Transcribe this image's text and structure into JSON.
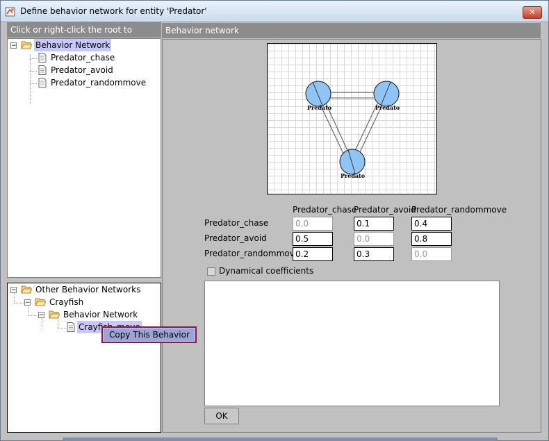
{
  "window": {
    "title": "Define behavior network for entity 'Predator'",
    "close_glyph": "✕"
  },
  "left_header": "Click or right-click the root to continue.",
  "tree_top": {
    "root": {
      "label": "Behavior Network",
      "toggle": "−"
    },
    "children": [
      "Predator_chase",
      "Predator_avoid",
      "Predator_randommove"
    ]
  },
  "tree_bottom": {
    "root": {
      "label": "Other Behavior Networks",
      "toggle": "−"
    },
    "crayfish": {
      "label": "Crayfish",
      "toggle": "−"
    },
    "behavior_network": {
      "label": "Behavior Network",
      "toggle": "−"
    },
    "leaf": {
      "label": "Crayfish_move"
    }
  },
  "context_menu": {
    "item": "Copy This Behavior"
  },
  "right_header": "Behavior network",
  "graph": {
    "node_label": "Predato"
  },
  "matrix": {
    "columns": [
      "Predator_chase",
      "Predator_avoid",
      "Predator_randommove"
    ],
    "rows": [
      {
        "label": "Predator_chase",
        "values": [
          "0.0",
          "0.1",
          "0.4"
        ]
      },
      {
        "label": "Predator_avoid",
        "values": [
          "0.5",
          "0.0",
          "0.8"
        ]
      },
      {
        "label": "Predator_randommove",
        "values": [
          "0.2",
          "0.3",
          "0.0"
        ]
      }
    ]
  },
  "dynamical_label": "Dynamical coefficients",
  "ok_label": "OK"
}
